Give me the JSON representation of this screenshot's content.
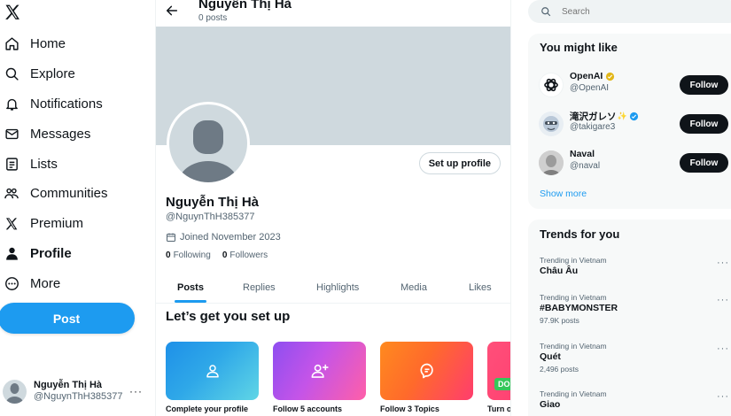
{
  "nav": {
    "items": [
      {
        "label": "Home",
        "icon": "home-icon"
      },
      {
        "label": "Explore",
        "icon": "search-icon"
      },
      {
        "label": "Notifications",
        "icon": "bell-icon"
      },
      {
        "label": "Messages",
        "icon": "envelope-icon"
      },
      {
        "label": "Lists",
        "icon": "list-icon"
      },
      {
        "label": "Communities",
        "icon": "people-icon"
      },
      {
        "label": "Premium",
        "icon": "x-logo-icon"
      },
      {
        "label": "Profile",
        "icon": "person-icon"
      },
      {
        "label": "More",
        "icon": "more-circle-icon"
      }
    ],
    "active": "Profile",
    "post_label": "Post",
    "account": {
      "name": "Nguyễn Thị Hà",
      "handle": "@NguynThH385377",
      "more": "···"
    }
  },
  "header": {
    "name": "Nguyễn Thị Hà",
    "posts": "0 posts"
  },
  "profile": {
    "setup_button": "Set up profile",
    "name": "Nguyễn Thị Hà",
    "handle": "@NguynThH385377",
    "joined": "Joined November 2023",
    "following_count": "0",
    "following_label": "Following",
    "followers_count": "0",
    "followers_label": "Followers"
  },
  "tabs": [
    "Posts",
    "Replies",
    "Highlights",
    "Media",
    "Likes"
  ],
  "active_tab": "Posts",
  "setup": {
    "title": "Let’s get you set up",
    "cards": [
      {
        "label": "Complete your profile",
        "icon": "person-outline-icon"
      },
      {
        "label": "Follow 5 accounts",
        "icon": "person-plus-icon"
      },
      {
        "label": "Follow 3 Topics",
        "icon": "topic-bubble-icon"
      },
      {
        "label": "Turn o",
        "badge": "DO"
      }
    ]
  },
  "search": {
    "placeholder": "Search"
  },
  "who_to_follow": {
    "title": "You might like",
    "accounts": [
      {
        "name": "OpenAI",
        "handle": "@OpenAI",
        "badge": "gold-verified-icon"
      },
      {
        "name": "滝沢ガレソ",
        "handle": "@takigare3",
        "badge": "blue-verified-icon",
        "emoji": "✨"
      },
      {
        "name": "Naval",
        "handle": "@naval"
      }
    ],
    "follow_label": "Follow",
    "show_more": "Show more"
  },
  "trends": {
    "title": "Trends for you",
    "items": [
      {
        "context": "Trending in Vietnam",
        "topic": "Châu Âu",
        "count": ""
      },
      {
        "context": "Trending in Vietnam",
        "topic": "#BABYMONSTER",
        "count": "97.9K posts"
      },
      {
        "context": "Trending in Vietnam",
        "topic": "Quét",
        "count": "2,496 posts"
      },
      {
        "context": "Trending in Vietnam",
        "topic": "Giao",
        "count": ""
      }
    ],
    "more": "···"
  },
  "colors": {
    "accent": "#1d9bf0",
    "text": "#0f1419",
    "muted": "#536471",
    "panel": "#f7f9f9"
  }
}
